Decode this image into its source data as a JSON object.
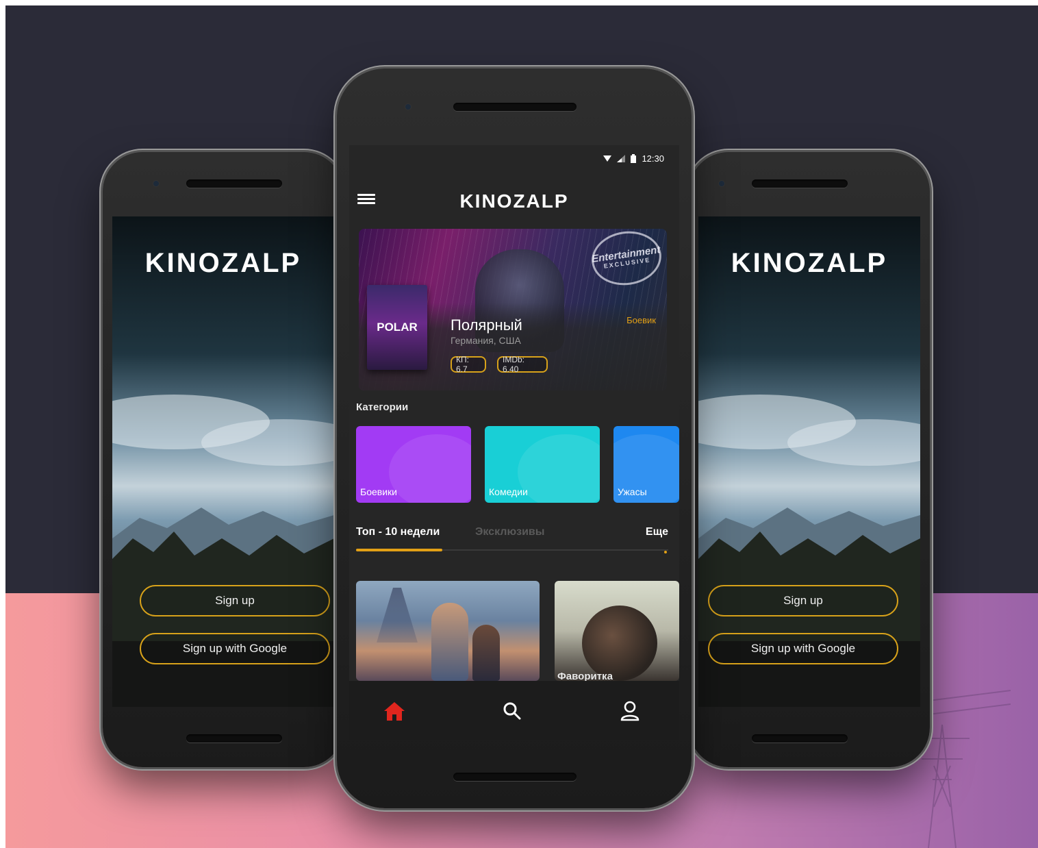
{
  "brand": "KINOZALP",
  "side_screen": {
    "sign_up": "Sign up",
    "sign_up_google": "Sign up with Google"
  },
  "main_screen": {
    "status": {
      "time": "12:30"
    },
    "hero": {
      "poster_title": "POLAR",
      "title": "Полярный",
      "country": "Германия, США",
      "genre": "Боевик",
      "rating_kp": "КП: 6.7",
      "rating_imdb": "IMDb: 6.40",
      "badge_title": "Entertainment",
      "badge_sub": "EXCLUSIVE"
    },
    "categories_title": "Категории",
    "categories": [
      {
        "label": "Боевики",
        "color": "#a23bf4"
      },
      {
        "label": "Комедии",
        "color": "#19cfd6"
      },
      {
        "label": "Ужасы",
        "color": "#1e88f0"
      }
    ],
    "tabs": {
      "active": "Топ - 10 недели",
      "inactive": "Эксклюзивы",
      "more": "Еще"
    },
    "movies": [
      {
        "label": ""
      },
      {
        "label": "Фаворитка"
      }
    ],
    "bottom_nav": [
      "home-icon",
      "search-icon",
      "profile-icon"
    ]
  },
  "colors": {
    "accent": "#e2a016",
    "home_active": "#e0261e",
    "background_top": "#2b2b38"
  }
}
